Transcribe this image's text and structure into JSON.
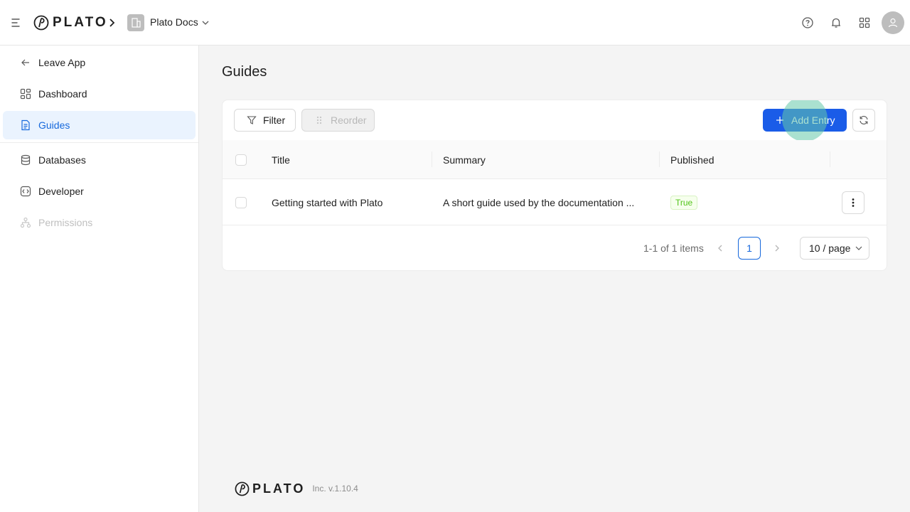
{
  "app": {
    "brand": "PLATO",
    "workspace": "Plato Docs"
  },
  "sidebar": {
    "items": [
      {
        "label": "Leave App",
        "icon": "arrow-left-icon"
      },
      {
        "label": "Dashboard",
        "icon": "dashboard-icon"
      },
      {
        "label": "Guides",
        "icon": "document-icon",
        "active": true
      },
      {
        "label": "Databases",
        "icon": "database-icon"
      },
      {
        "label": "Developer",
        "icon": "code-icon"
      },
      {
        "label": "Permissions",
        "icon": "hierarchy-icon",
        "disabled": true
      }
    ]
  },
  "main": {
    "title": "Guides",
    "toolbar": {
      "filter_label": "Filter",
      "reorder_label": "Reorder",
      "add_label": "Add Entry"
    },
    "table": {
      "columns": [
        "Title",
        "Summary",
        "Published"
      ],
      "rows": [
        {
          "title": "Getting started with Plato",
          "summary": "A short guide used by the documentation ...",
          "published": "True"
        }
      ]
    },
    "pagination": {
      "total_text": "1-1 of 1 items",
      "current_page": "1",
      "page_size": "10 / page"
    }
  },
  "footer": {
    "brand": "PLATO",
    "version": "Inc. v.1.10.4"
  },
  "colors": {
    "primary": "#1a5ce8",
    "active_bg": "#eaf3fe",
    "tag_green": "#52c41a"
  }
}
